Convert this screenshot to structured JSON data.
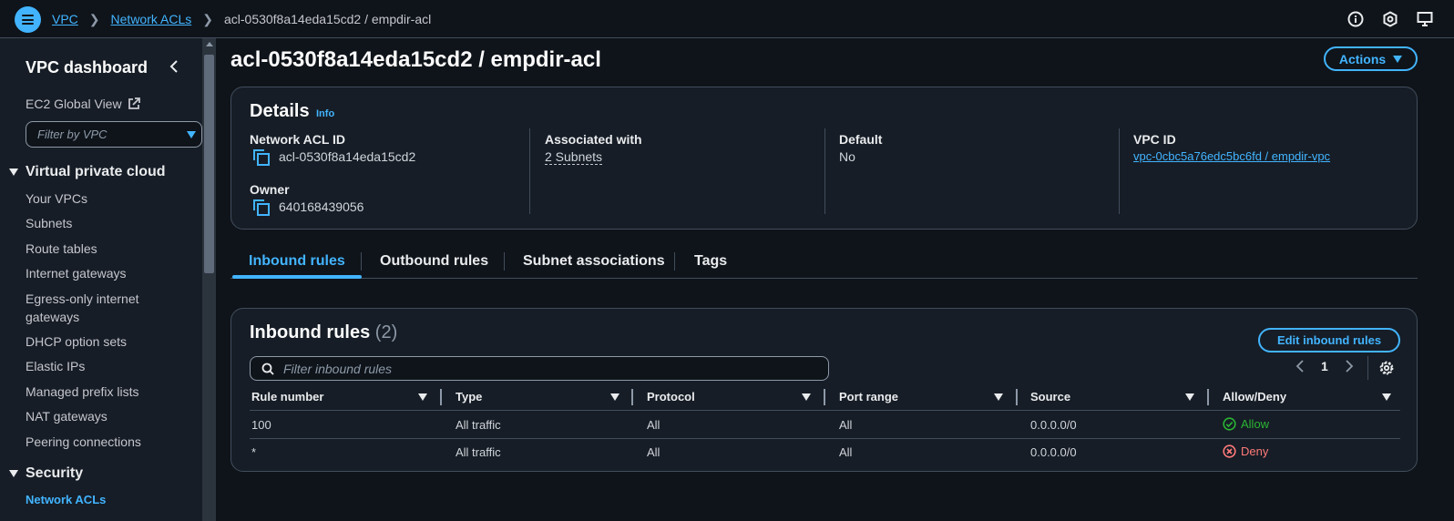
{
  "topbar": {
    "breadcrumbs": [
      "VPC",
      "Network ACLs",
      "acl-0530f8a14eda15cd2 / empdir-acl"
    ]
  },
  "sidebar": {
    "title": "VPC dashboard",
    "ec2_global_view": "EC2 Global View",
    "filter_placeholder": "Filter by VPC",
    "section_vpc": "Virtual private cloud",
    "items": [
      "Your VPCs",
      "Subnets",
      "Route tables",
      "Internet gateways",
      "Egress-only internet",
      "gateways",
      "DHCP option sets",
      "Elastic IPs",
      "Managed prefix lists",
      "NAT gateways",
      "Peering connections"
    ],
    "section_security": "Security",
    "active_item": "Network ACLs"
  },
  "page": {
    "title": "acl-0530f8a14eda15cd2 / empdir-acl",
    "actions": "Actions"
  },
  "details": {
    "heading": "Details",
    "info": "Info",
    "acl_id_label": "Network ACL ID",
    "acl_id": "acl-0530f8a14eda15cd2",
    "owner_label": "Owner",
    "owner": "640168439056",
    "assoc_label": "Associated with",
    "assoc": "2 Subnets",
    "default_label": "Default",
    "default": "No",
    "vpc_label": "VPC ID",
    "vpc": "vpc-0cbc5a76edc5bc6fd / empdir-vpc"
  },
  "tabs": [
    "Inbound rules",
    "Outbound rules",
    "Subnet associations",
    "Tags"
  ],
  "rules": {
    "heading": "Inbound rules",
    "count": "(2)",
    "edit": "Edit inbound rules",
    "search_placeholder": "Filter inbound rules",
    "page": "1",
    "columns": [
      "Rule number",
      "Type",
      "Protocol",
      "Port range",
      "Source",
      "Allow/Deny"
    ],
    "rows": [
      [
        "100",
        "All traffic",
        "All",
        "All",
        "0.0.0.0/0",
        "Allow"
      ],
      [
        "*",
        "All traffic",
        "All",
        "All",
        "0.0.0.0/0",
        "Deny"
      ]
    ]
  }
}
